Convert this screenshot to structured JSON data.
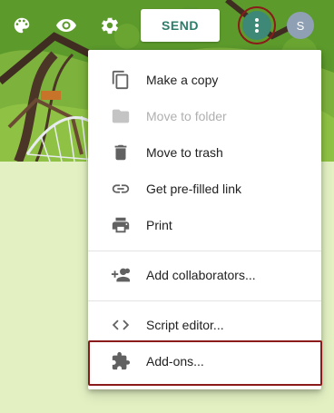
{
  "toolbar": {
    "send_label": "SEND",
    "avatar_initial": "S",
    "icons": [
      "palette-icon",
      "eye-icon",
      "gear-icon",
      "more-vert-icon"
    ]
  },
  "menu": {
    "items": [
      {
        "label": "Make a copy",
        "icon": "copy-icon",
        "enabled": true
      },
      {
        "label": "Move to folder",
        "icon": "folder-icon",
        "enabled": false
      },
      {
        "label": "Move to trash",
        "icon": "trash-icon",
        "enabled": true
      },
      {
        "label": "Get pre-filled link",
        "icon": "link-icon",
        "enabled": true
      },
      {
        "label": "Print",
        "icon": "print-icon",
        "enabled": true
      },
      {
        "label": "Add collaborators...",
        "icon": "add-people-icon",
        "enabled": true
      },
      {
        "label": "Script editor...",
        "icon": "code-icon",
        "enabled": true
      },
      {
        "label": "Add-ons...",
        "icon": "puzzle-icon",
        "enabled": true
      }
    ]
  },
  "colors": {
    "theme": "#3d8876",
    "send_text": "#2e7d6b",
    "background": "#e2f0c2",
    "highlight": "#8b1a1a"
  }
}
